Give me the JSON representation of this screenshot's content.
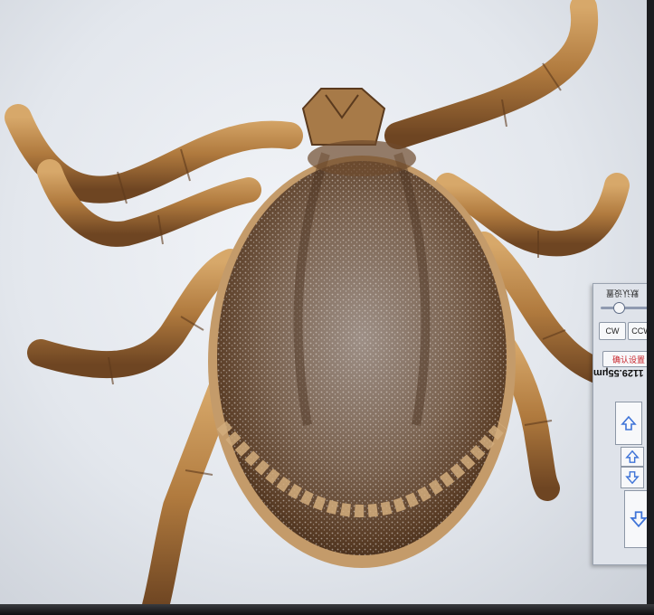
{
  "panel": {
    "reset_label": "默认设置",
    "ccw_label": "CCW",
    "cw_label": "CW",
    "red_button_label": "确认设置",
    "measurement": "1129.55μm"
  },
  "colors": {
    "leg": "#b8864a",
    "leg_dark": "#6b4320",
    "scutum": "#8a6b52",
    "body_rim": "#c49b6a",
    "arrow": "#3f74d8"
  },
  "icons": [
    "arrow-up-icon",
    "arrow-down-icon"
  ]
}
